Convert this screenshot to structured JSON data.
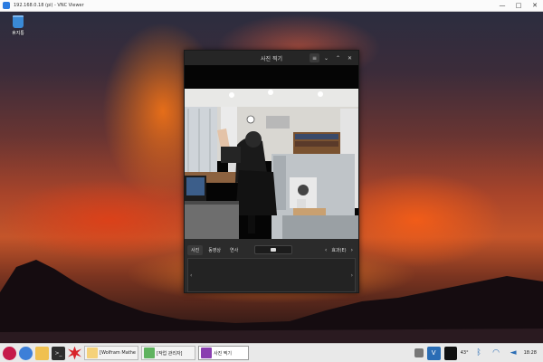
{
  "vnc": {
    "title": "192.168.0.18 (pi) - VNC Viewer",
    "controls": [
      "—",
      "□",
      "✕"
    ]
  },
  "desktop": {
    "trash_label": "휴지통"
  },
  "camera_window": {
    "title": "사진 찍기",
    "menu_icon": "≡",
    "minimize_icon": "⌄",
    "maximize_icon": "⌃",
    "close_icon": "✕",
    "modes": [
      "사진",
      "동영상",
      "연사"
    ],
    "prev_arrow": "‹",
    "effect_label": "효과(E)",
    "next_arrow": "›",
    "thumb_prev": "‹",
    "thumb_next": "›"
  },
  "taskbar": {
    "tasks": [
      {
        "label": "[Wolfram Mathem...",
        "icon_color": "#f5d27a"
      },
      {
        "label": "[작업 관리자]",
        "icon_color": "#5fb35f"
      },
      {
        "label": "사진 찍기",
        "icon_color": "#8a3fb0"
      }
    ],
    "temperature": "43°",
    "clock": "18:28",
    "colors": {
      "raspberry": "#c51a4a",
      "globe": "#3d7fd8",
      "folder": "#f0c050",
      "terminal": "#2d2d2d",
      "burst": "#d8232a"
    }
  }
}
